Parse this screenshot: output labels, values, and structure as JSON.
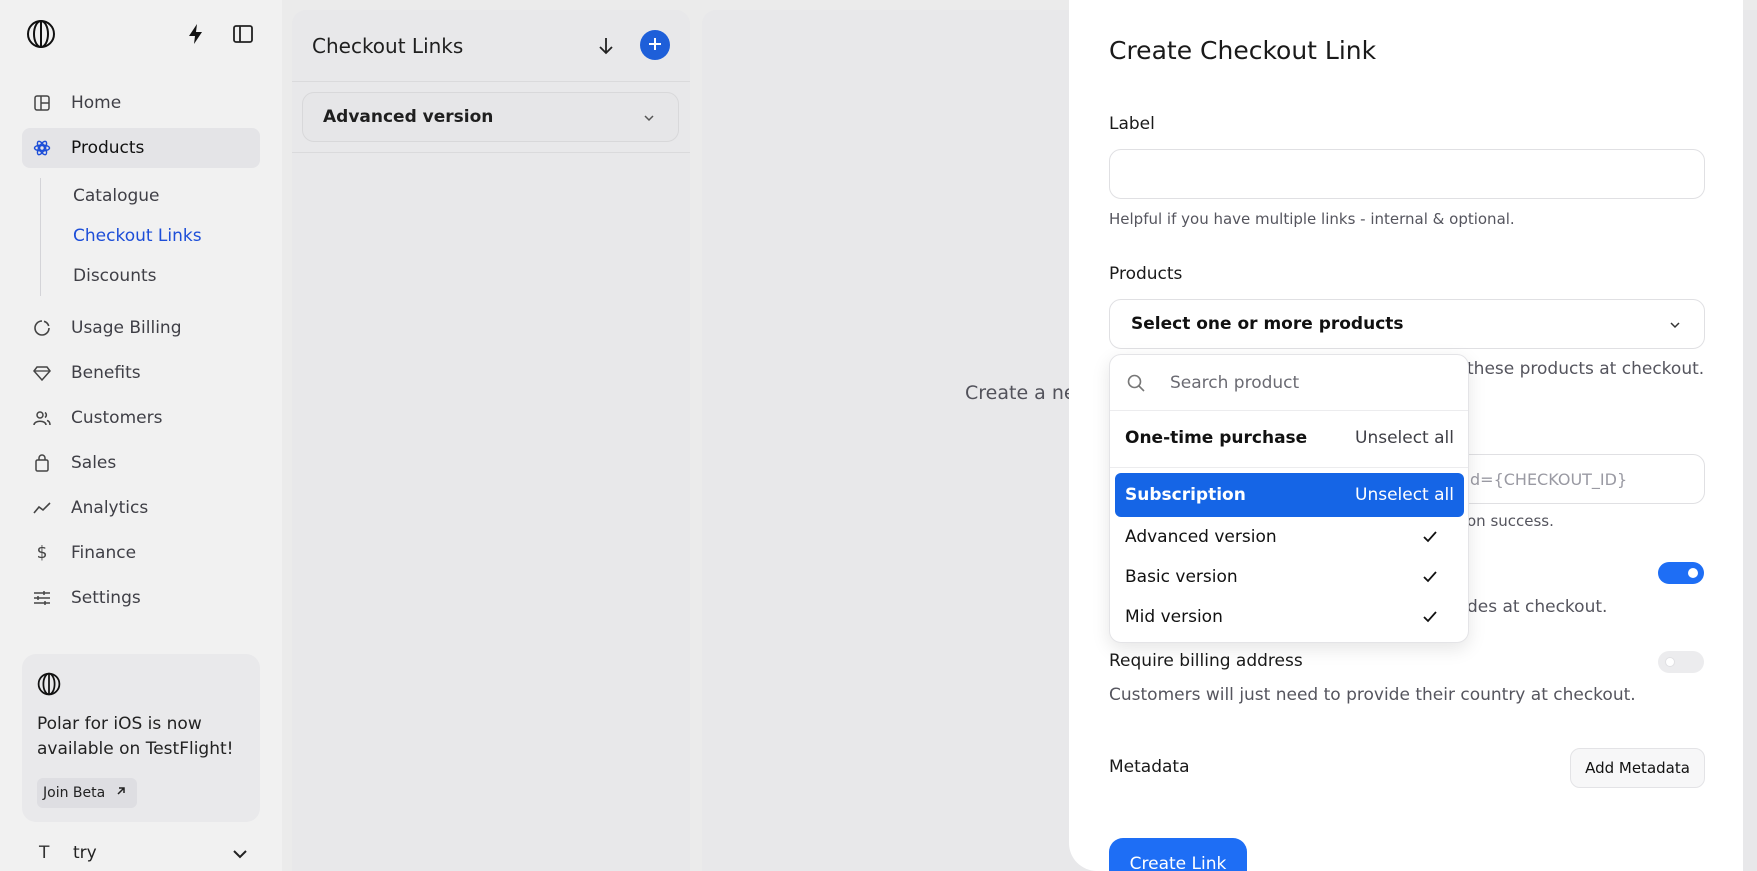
{
  "sidebar": {
    "logo_icon": "polar-logo-icon",
    "quick_icon": "lightning-icon",
    "toggle_icon": "sidebar-toggle-icon",
    "nav": [
      {
        "label": "Home",
        "icon": "home-icon"
      },
      {
        "label": "Products",
        "icon": "products-icon",
        "active": true
      },
      {
        "label": "Usage Billing",
        "icon": "usage-billing-icon"
      },
      {
        "label": "Benefits",
        "icon": "benefits-icon"
      },
      {
        "label": "Customers",
        "icon": "customers-icon"
      },
      {
        "label": "Sales",
        "icon": "sales-icon"
      },
      {
        "label": "Analytics",
        "icon": "analytics-icon"
      },
      {
        "label": "Finance",
        "icon": "finance-icon"
      },
      {
        "label": "Settings",
        "icon": "settings-icon"
      }
    ],
    "sub_nav": [
      {
        "label": "Catalogue"
      },
      {
        "label": "Checkout Links",
        "active": true
      },
      {
        "label": "Discounts"
      }
    ],
    "promo": {
      "text": "Polar for iOS is now available on TestFlight!",
      "button": "Join Beta"
    },
    "workspace": {
      "initial": "T",
      "name": "try"
    }
  },
  "list_panel": {
    "title": "Checkout Links",
    "selected": "Advanced version"
  },
  "main": {
    "hint": "Create a new checkout link"
  },
  "modal": {
    "title": "Create Checkout Link",
    "label_field": {
      "label": "Label",
      "value": "",
      "help": "Helpful if you have multiple links - internal & optional."
    },
    "products_field": {
      "label": "Products",
      "placeholder": "Select one or more products",
      "help_visible": "these products at checkout."
    },
    "success_url": {
      "value_visible": "d={CHECKOUT_ID}",
      "help_visible": "on success."
    },
    "discount": {
      "help_visible": "des at checkout.",
      "toggle_on": true
    },
    "billing": {
      "label": "Require billing address",
      "help": "Customers will just need to provide their country at checkout.",
      "toggle_on": false
    },
    "metadata": {
      "label": "Metadata",
      "button": "Add Metadata"
    },
    "submit": "Create Link"
  },
  "dropdown": {
    "search_placeholder": "Search product",
    "groups": [
      {
        "name": "One-time purchase",
        "action": "Unselect all",
        "highlighted": false,
        "items": []
      },
      {
        "name": "Subscription",
        "action": "Unselect all",
        "highlighted": true,
        "items": [
          {
            "label": "Advanced version",
            "checked": true
          },
          {
            "label": "Basic version",
            "checked": true
          },
          {
            "label": "Mid version",
            "checked": true
          }
        ]
      }
    ]
  },
  "colors": {
    "accent": "#1E6EF5",
    "highlight": "#1565E6",
    "active_link": "#1D4ED8"
  }
}
